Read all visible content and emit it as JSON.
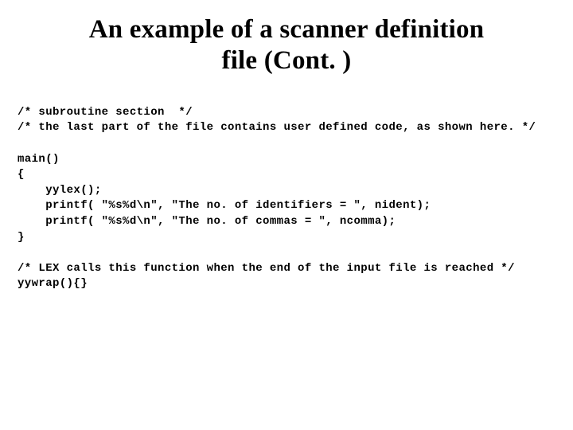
{
  "title_line1": "An example of a scanner definition",
  "title_line2": "file (Cont. )",
  "code_lines": {
    "l01": "/* subroutine section  */",
    "l02": "/* the last part of the file contains user defined code, as shown here. */",
    "l03": "",
    "l04": "main()",
    "l05": "{",
    "l06": "    yylex();",
    "l07": "    printf( \"%s%d\\n\", \"The no. of identifiers = \", nident);",
    "l08": "    printf( \"%s%d\\n\", \"The no. of commas = \", ncomma);",
    "l09": "}",
    "l10": "",
    "l11": "/* LEX calls this function when the end of the input file is reached */",
    "l12": "yywrap(){}"
  }
}
